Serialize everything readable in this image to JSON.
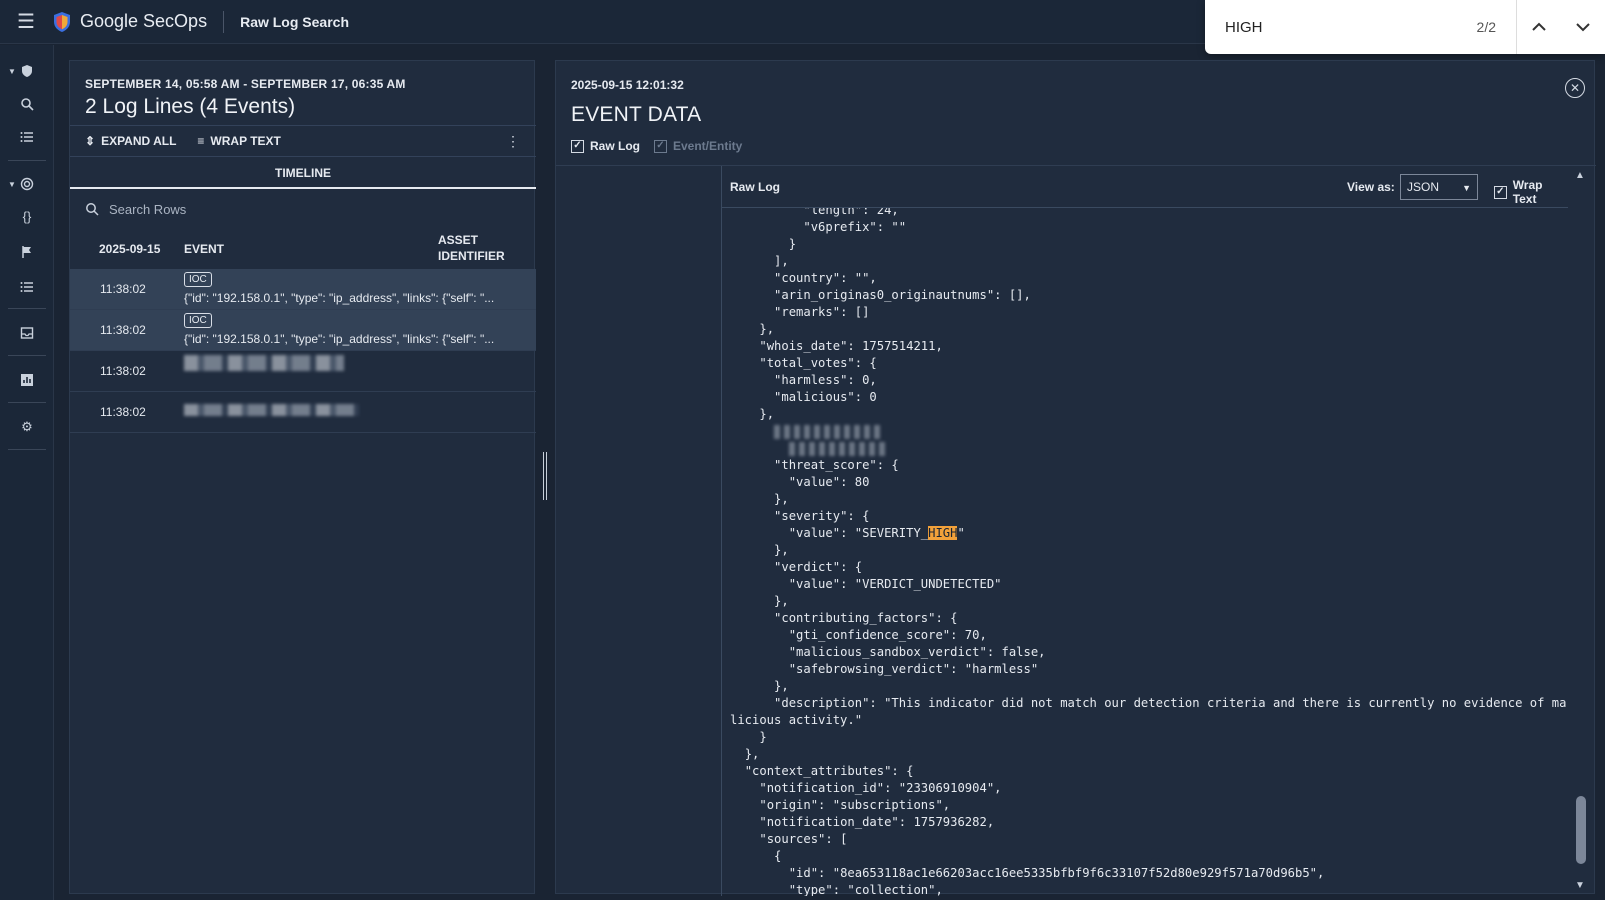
{
  "app": {
    "name": "Google SecOps",
    "page_title": "Raw Log Search"
  },
  "find": {
    "query": "HIGH",
    "count": "2/2"
  },
  "left_panel": {
    "range": "SEPTEMBER 14, 05:58 AM - SEPTEMBER 17, 06:35 AM",
    "title": "2 Log Lines (4 Events)",
    "expand_all": "EXPAND ALL",
    "wrap_text": "WRAP TEXT",
    "tab": "TIMELINE",
    "search_placeholder": "Search Rows",
    "columns": {
      "date": "2025-09-15",
      "event": "EVENT",
      "asset": "ASSET IDENTIFIER"
    },
    "rows": [
      {
        "time": "11:38:02",
        "badge": "IOC",
        "event": "{\"id\": \"192.158.0.1\", \"type\": \"ip_address\", \"links\": {\"self\": \"...",
        "selected": true
      },
      {
        "time": "11:38:02",
        "badge": "IOC",
        "event": "{\"id\": \"192.158.0.1\", \"type\": \"ip_address\", \"links\": {\"self\": \"...",
        "selected": true
      },
      {
        "time": "11:38:02"
      },
      {
        "time": "11:38:02"
      }
    ]
  },
  "right_panel": {
    "timestamp": "2025-09-15 12:01:32",
    "title": "EVENT DATA",
    "raw_log_check": "Raw Log",
    "event_entity_check": "Event/Entity",
    "header_label": "Raw Log",
    "view_as_label": "View as:",
    "view_as_value": "JSON",
    "wrap_text": "Wrap Text"
  },
  "code": {
    "pre_lines": [
      "          \"length\": 24,",
      "          \"v6prefix\": \"\"",
      "        }",
      "      ],",
      "      \"country\": \"\",",
      "      \"arin_originas0_originautnums\": [],",
      "      \"remarks\": []",
      "    },",
      "    \"whois_date\": 1757514211,",
      "    \"total_votes\": {",
      "      \"harmless\": 0,",
      "      \"malicious\": 0",
      "    },"
    ],
    "blur_line_a": "      ",
    "blur_line_b": "        ",
    "mid_lines": [
      "      \"threat_score\": {",
      "        \"value\": 80",
      "      },",
      "      \"severity\": {"
    ],
    "sev_prefix": "        \"value\": \"SEVERITY_",
    "sev_match": "HIGH",
    "sev_suffix": "\"",
    "post_lines": [
      "      },",
      "      \"verdict\": {",
      "        \"value\": \"VERDICT_UNDETECTED\"",
      "      },",
      "      \"contributing_factors\": {",
      "        \"gti_confidence_score\": 70,",
      "        \"malicious_sandbox_verdict\": false,",
      "        \"safebrowsing_verdict\": \"harmless\"",
      "      },",
      "      \"description\": \"This indicator did not match our detection criteria and there is currently no evidence of malicious activity.\"",
      "    }",
      "  },",
      "  \"context_attributes\": {",
      "    \"notification_id\": \"23306910904\",",
      "    \"origin\": \"subscriptions\",",
      "    \"notification_date\": 1757936282,",
      "    \"sources\": [",
      "      {",
      "        \"id\": \"8ea653118ac1e66203acc16ee5335bfbf9f6c33107f52d80e929f571a70d96b5\",",
      "        \"type\": \"collection\","
    ]
  },
  "icons": {
    "menu": "hamburger-icon",
    "logo": "secops-shield-icon",
    "find_up": "chevron-up-icon",
    "find_down": "chevron-down-icon",
    "close": "close-circle-icon"
  },
  "colors": {
    "highlight": "#f2a13a",
    "background": "#1a2433",
    "panel": "#202c3e"
  }
}
